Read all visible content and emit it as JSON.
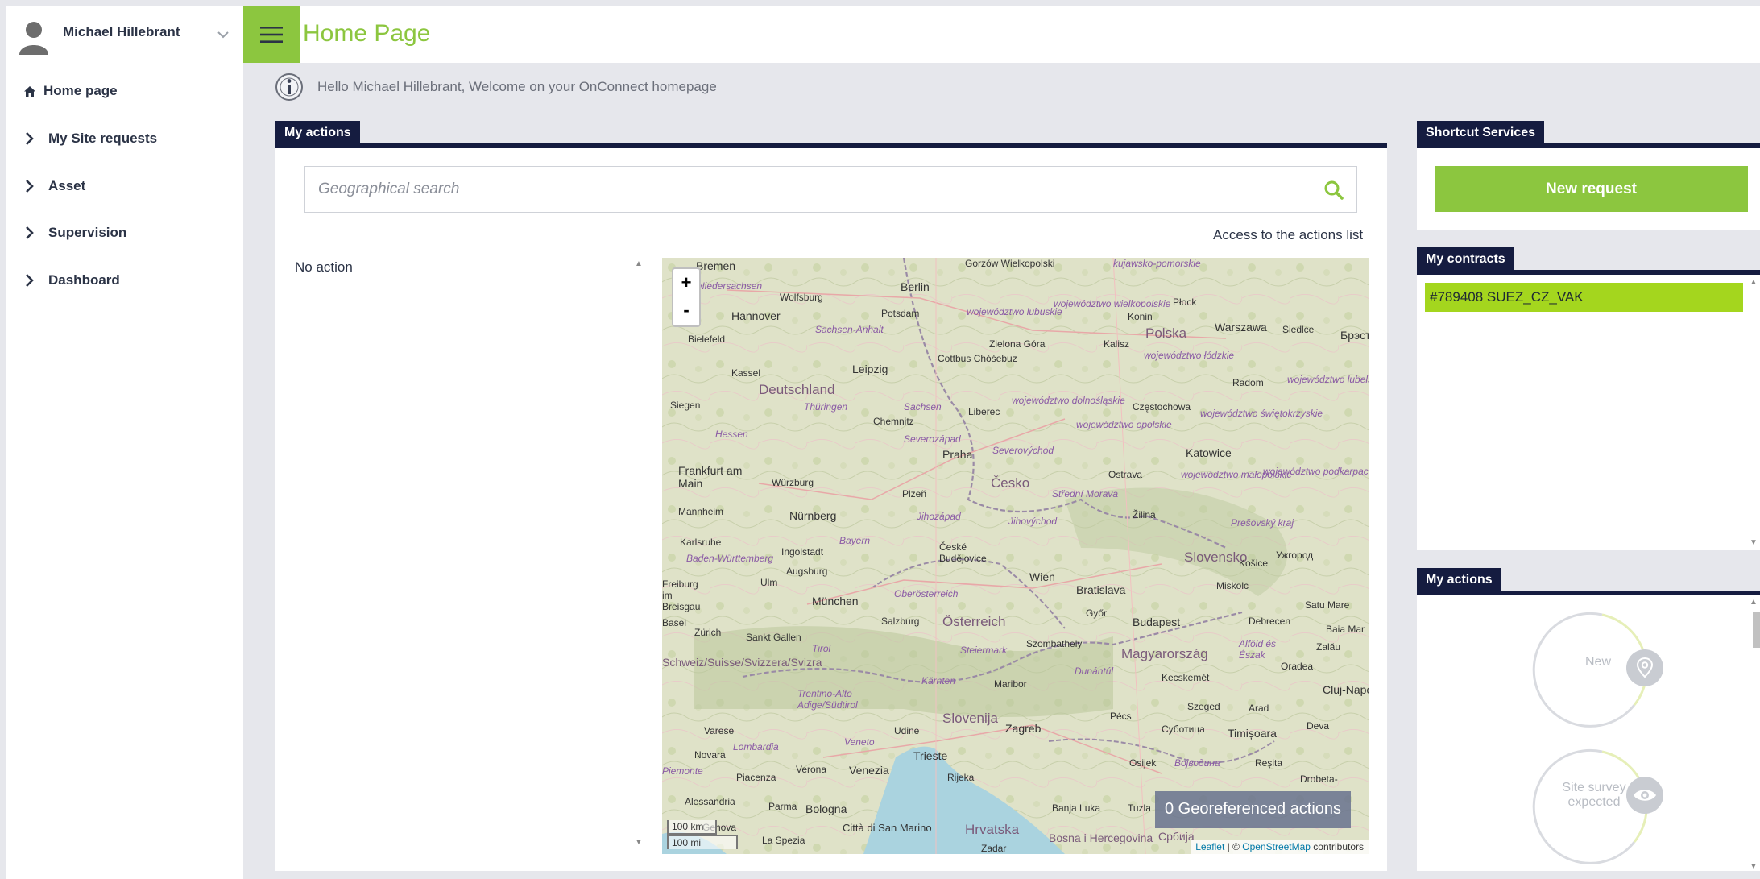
{
  "user": {
    "name": "Michael Hillebrant"
  },
  "nav": {
    "items": [
      {
        "label": "Home page",
        "icon": "home-icon"
      },
      {
        "label": "My Site requests",
        "icon": "chevron-right-icon"
      },
      {
        "label": "Asset",
        "icon": "chevron-right-icon"
      },
      {
        "label": "Supervision",
        "icon": "chevron-right-icon"
      },
      {
        "label": "Dashboard",
        "icon": "chevron-right-icon"
      }
    ]
  },
  "header": {
    "title": "Home Page"
  },
  "welcome": {
    "text": "Hello Michael Hillebrant, Welcome on your OnConnect homepage"
  },
  "my_actions": {
    "title": "My actions",
    "search_placeholder": "Geographical search",
    "access_link": "Access to the actions list",
    "empty_text": "No action"
  },
  "map": {
    "zoom_in": "+",
    "zoom_out": "-",
    "georef_count": "0 Georeferenced actions",
    "attribution_leaflet": "Leaflet",
    "attribution_sep": " | © ",
    "attribution_osm": "OpenStreetMap",
    "attribution_tail": " contributors",
    "scale_km": "100 km",
    "scale_mi": "100 mi",
    "labels": {
      "bremen": "Bremen",
      "niedersachsen": "Niedersachsen",
      "wolfsburg": "Wolfsburg",
      "berlin": "Berlin",
      "gorzow": "Gorzów Wielkopolski",
      "kujawsko": "kujawsko-pomorskie",
      "hannover": "Hannover",
      "potsdam": "Potsdam",
      "lubuskie": "województwo lubuskie",
      "wielkopolskie": "województwo wielkopolskie",
      "konin": "Konin",
      "plock": "Płock",
      "warszawa": "Warszawa",
      "siedlce": "Siedlce",
      "brest": "Брэст",
      "bielefeld": "Bielefeld",
      "sachsen_anhalt": "Sachsen-Anhalt",
      "zielona": "Zielona Góra",
      "polska": "Polska",
      "kalisz": "Kalisz",
      "lodzkie": "województwo łódzkie",
      "kassel": "Kassel",
      "leipzig": "Leipzig",
      "cottbus": "Cottbus Chóśebuz",
      "radom": "Radom",
      "lubelskie": "województwo lubelskie",
      "deutschland": "Deutschland",
      "thuringen": "Thüringen",
      "sachsen": "Sachsen",
      "dolnoslaskie": "województwo dolnośląskie",
      "czestochowa": "Częstochowa",
      "swietokrzyskie": "województwo świętokrzyskie",
      "siegen": "Siegen",
      "chemnitz": "Chemnitz",
      "liberec": "Liberec",
      "opolskie": "województwo opolskie",
      "hessen": "Hessen",
      "severozapad": "Severozápad",
      "praha": "Praha",
      "severovychod": "Severovýchod",
      "katowice": "Katowice",
      "frankfurt": "Frankfurt am Main",
      "wurzburg": "Würzburg",
      "plzen": "Plzeň",
      "cesko": "Česko",
      "ostrava": "Ostrava",
      "malopolskie": "województwo małopolskie",
      "podkarpackie": "województwo podkarpackie",
      "stredni_morava": "Střední Morava",
      "mannheim": "Mannheim",
      "nurnberg": "Nürnberg",
      "jihozapad": "Jihozápad",
      "jihovychod": "Jihovýchod",
      "zilina": "Žilina",
      "presov": "Prešovský kraj",
      "karlsruhe": "Karlsruhe",
      "bayern": "Bayern",
      "ceske_budejovice": "České Budějovice",
      "ingolstadt": "Ingolstadt",
      "bw": "Baden-Württemberg",
      "slovensko": "Slovensko",
      "kosice": "Košice",
      "uzhhorod": "Ужгород",
      "augsburg": "Augsburg",
      "freiburg": "Freiburg im Breisgau",
      "ulm": "Ulm",
      "oberosterreich": "Oberösterreich",
      "wien": "Wien",
      "bratislava": "Bratislava",
      "miskolc": "Miskolc",
      "munchen": "München",
      "gyor": "Győr",
      "satu_mare": "Satu Mare",
      "basel": "Basel",
      "salzburg": "Salzburg",
      "osterreich": "Österreich",
      "budapest": "Budapest",
      "debrecen": "Debrecen",
      "baia_mare": "Baia Mar",
      "zurich": "Zürich",
      "sankt_gallen": "Sankt Gallen",
      "tirol": "Tirol",
      "steiermark": "Steiermark",
      "szombathely": "Szombathely",
      "alfold": "Alföld és Észak",
      "zalau": "Zalău",
      "schweiz": "Schweiz/Suisse/Svizzera/Svizra",
      "magyarorszag": "Magyarország",
      "oradea": "Oradea",
      "karnten": "Kärnten",
      "maribor": "Maribor",
      "dunantul": "Dunántúl",
      "kecskemet": "Kecskemét",
      "trentino": "Trentino-Alto Adige/Südtirol",
      "cluj": "Cluj-Napo",
      "slovenija": "Slovenija",
      "szeged": "Szeged",
      "arad": "Arad",
      "varese": "Varese",
      "udine": "Udine",
      "zagreb": "Zagreb",
      "pecs": "Pécs",
      "subotica": "Суботица",
      "timisoara": "Timișoara",
      "deva": "Deva",
      "lombardia": "Lombardia",
      "veneto": "Veneto",
      "novara": "Novara",
      "trieste": "Trieste",
      "osijek": "Osijek",
      "vojvodina": "Војводина",
      "resita": "Reșita",
      "piemonte": "Piemonte",
      "verona": "Verona",
      "venezia": "Venezia",
      "piacenza": "Piacenza",
      "rijeka": "Rijeka",
      "drobeta": "Drobeta-",
      "alessandria": "Alessandria",
      "parma": "Parma",
      "bologna": "Bologna",
      "banja_luka": "Banja Luka",
      "tuzla": "Tuzla",
      "genova": "Genova",
      "la_spezia": "La Spezia",
      "citta": "Città di San Marino",
      "hrvatska": "Hrvatska",
      "bosna": "Bosna i Hercegovina",
      "srbija": "Србија",
      "zadar": "Zadar"
    }
  },
  "shortcuts": {
    "title": "Shortcut Services",
    "new_request": "New request"
  },
  "contracts": {
    "title": "My contracts",
    "items": [
      "#789408 SUEZ_CZ_VAK"
    ]
  },
  "right_actions": {
    "title": "My actions",
    "statuses": [
      {
        "label": "New",
        "icon": "map-pin-icon"
      },
      {
        "label": "Site survey expected",
        "icon": "eye-icon"
      }
    ]
  },
  "colors": {
    "accent": "#8cc63f",
    "navy": "#151c40",
    "contract": "#a4d61e"
  }
}
